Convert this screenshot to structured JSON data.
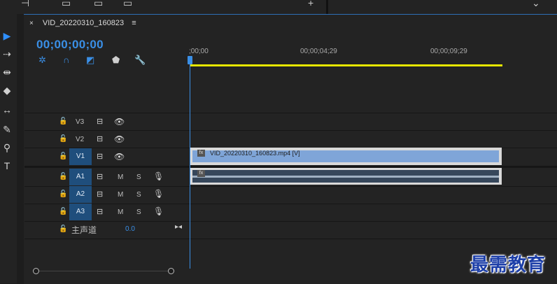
{
  "sequence": {
    "name": "VID_20220310_160823",
    "menu_icon": "hamburger-icon",
    "timecode": "00;00;00;00"
  },
  "ruler": {
    "ticks": [
      ";00;00",
      "00;00;04;29",
      "00;00;09;29"
    ]
  },
  "tracks": {
    "video": [
      {
        "label": "V3",
        "targeted": false
      },
      {
        "label": "V2",
        "targeted": false
      },
      {
        "label": "V1",
        "targeted": true
      }
    ],
    "audio": [
      {
        "label": "A1",
        "m": "M",
        "s": "S"
      },
      {
        "label": "A2",
        "m": "M",
        "s": "S"
      },
      {
        "label": "A3",
        "m": "M",
        "s": "S"
      }
    ],
    "master": {
      "label": "主声道",
      "value": "0.0"
    }
  },
  "clips": {
    "video_clip": "VID_20220310_160823.mp4 [V]",
    "fx_badge": "fx"
  },
  "watermark": "最需教育",
  "colors": {
    "accent": "#3a8fe6",
    "track_target": "#1f4e7c",
    "video_clip": "#7fa5d8",
    "audio_clip": "#36475b",
    "work_area": "#e6e600"
  }
}
